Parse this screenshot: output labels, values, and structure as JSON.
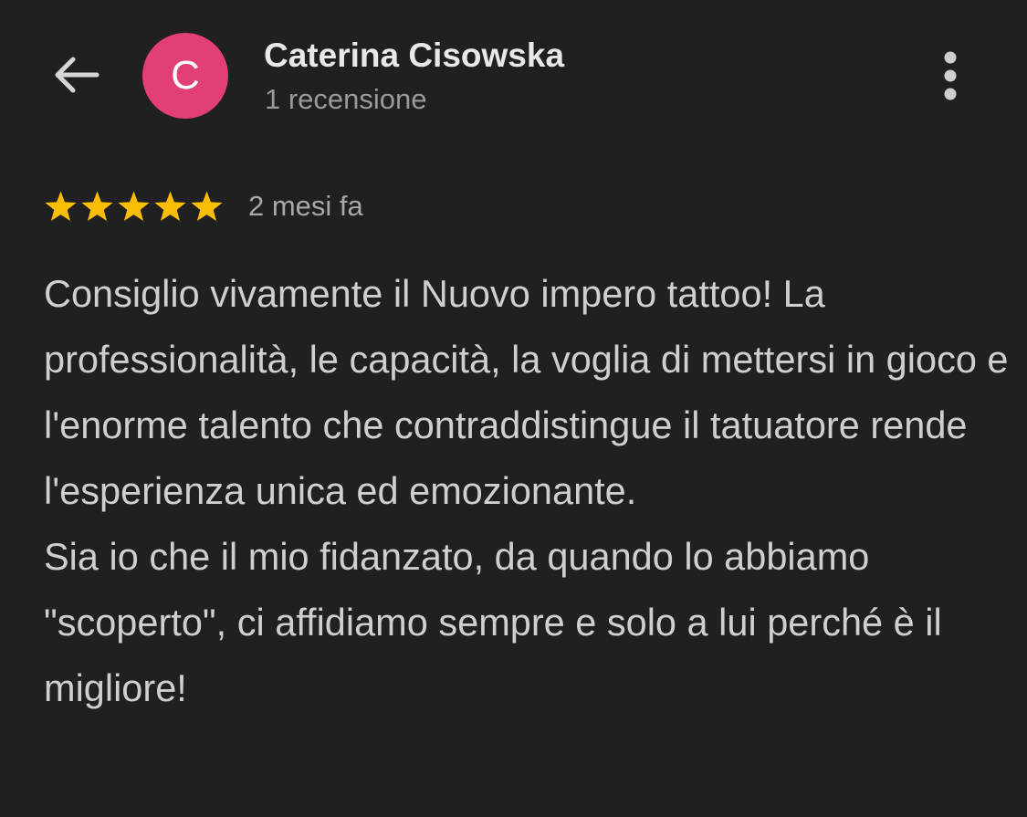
{
  "header": {
    "back_icon": "arrow-left-icon",
    "avatar_initial": "C",
    "avatar_color": "#e23f76",
    "reviewer_name": "Caterina Cisowska",
    "review_count": "1 recensione",
    "more_icon": "more-vertical-icon"
  },
  "review": {
    "rating": 5,
    "max_rating": 5,
    "star_color": "#fbbc04",
    "date": "2 mesi fa",
    "paragraphs": [
      "Consiglio vivamente il Nuovo impero tattoo! La professionalità, le capacità, la voglia di mettersi in gioco e l'enorme talento che contraddistingue il tatuatore rende l'esperienza unica ed emozionante.",
      "Sia io che il mio fidanzato, da quando lo abbiamo \"scoperto\", ci affidiamo sempre e solo a lui perché è il migliore!"
    ]
  },
  "colors": {
    "background": "#202020",
    "name_text": "#e8e8e8",
    "secondary_text": "#9a9a9a",
    "body_text": "#cfcfcf"
  }
}
